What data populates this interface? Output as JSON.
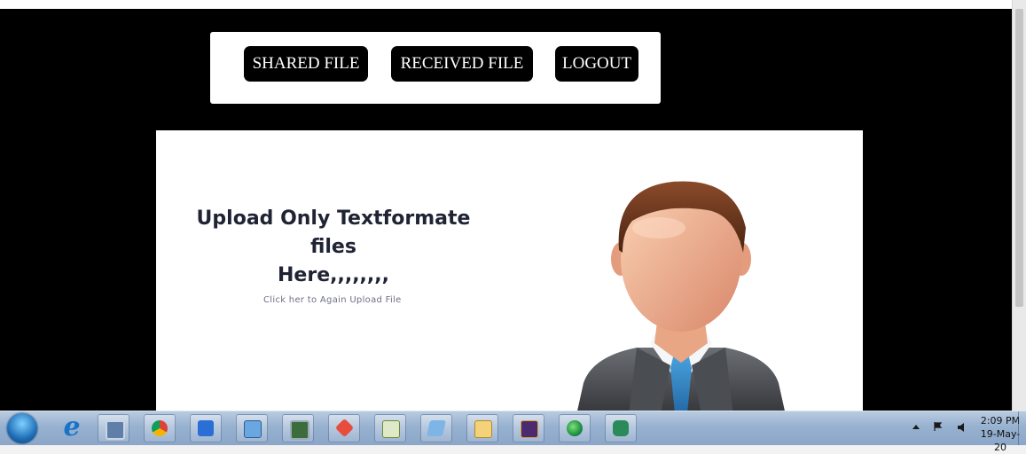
{
  "nav": {
    "shared_label": "SHARED FILE",
    "received_label": "RECEIVED FILE",
    "logout_label": "LOGOUT"
  },
  "content": {
    "heading_line1": "Upload Only Textformate files",
    "heading_line2": "Here,,,,,,,,",
    "again_link": "Click her to Again Upload File"
  },
  "taskbar": {
    "clock_time": "2:09 PM",
    "clock_date": "19-May-20",
    "pinned_apps": [
      "internet-explorer-icon",
      "calculator-icon",
      "chrome-icon",
      "wps-writer-icon",
      "control-panel-icon",
      "task-manager-icon",
      "git-icon",
      "notepad-plus-icon",
      "blank-document-icon",
      "file-explorer-icon",
      "java-ee-ide-icon",
      "network-icon",
      "node-icon"
    ]
  },
  "colors": {
    "page_background": "#000000",
    "button_background": "#000000",
    "button_text": "#ffffff",
    "heading_text": "#1f2333",
    "link_text": "#6d7085"
  }
}
